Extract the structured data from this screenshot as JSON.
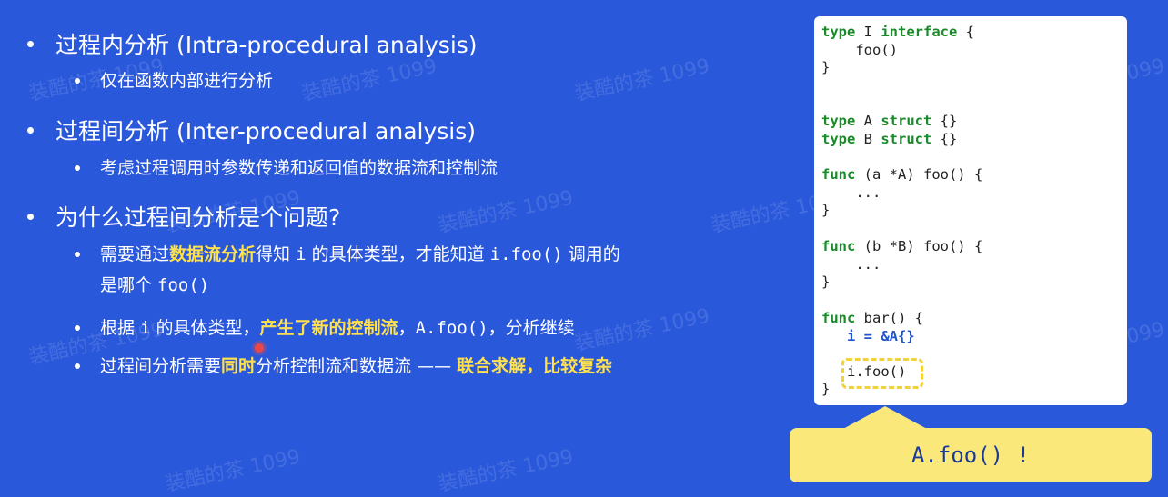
{
  "watermark": "装酷的茶 1099",
  "bullets": {
    "b1": "过程内分析 (Intra-procedural analysis)",
    "b1_1": "仅在函数内部进行分析",
    "b2": "过程间分析 (Inter-procedural analysis)",
    "b2_1": "考虑过程调用时参数传递和返回值的数据流和控制流",
    "b3": "为什么过程间分析是个问题?",
    "b3_1": {
      "p1": "需要通过",
      "hl1": "数据流分析",
      "p2": "得知 ",
      "c1": "i",
      "p3": " 的具体类型，才能知道 ",
      "c2": "i.foo()",
      "p4": " 调用的",
      "p5": "是哪个 ",
      "c3": "foo()"
    },
    "b3_2": {
      "p1": "根据 ",
      "c1": "i",
      "p2": " 的具体类型，",
      "hl1": "产生了新的控制流",
      "p3": "，",
      "c2": "A.foo()",
      "p4": "，分析继续"
    },
    "b3_3": {
      "p1": "过程间分析需要",
      "hl1": "同时",
      "p2": "分析控制流和数据流 —— ",
      "hl2": "联合求解，比较复杂"
    }
  },
  "code": {
    "l1_kw1": "type",
    "l1_t1": " I ",
    "l1_kw2": "interface",
    "l1_t2": " {",
    "l2": "    foo()",
    "l3": "}",
    "l4_kw1": "type",
    "l4_t1": " A ",
    "l4_kw2": "struct",
    "l4_t2": " {}",
    "l5_kw1": "type",
    "l5_t1": " B ",
    "l5_kw2": "struct",
    "l5_t2": " {}",
    "l6_kw": "func",
    "l6_t": " (a *A) foo() {",
    "l7": "    ...",
    "l8": "}",
    "l9_kw": "func",
    "l9_t": " (b *B) foo() {",
    "l10": "    ...",
    "l11": "}",
    "l12_kw": "func",
    "l12_t": " bar() {",
    "l13": "   i = &A{}",
    "l14": "   i.foo()",
    "l15": "}"
  },
  "callout": "A.foo() !",
  "colors": {
    "background": "#2a58db",
    "highlight": "#ffe14d",
    "keyword": "#1a8a2a",
    "callout": "#fbe87a"
  }
}
